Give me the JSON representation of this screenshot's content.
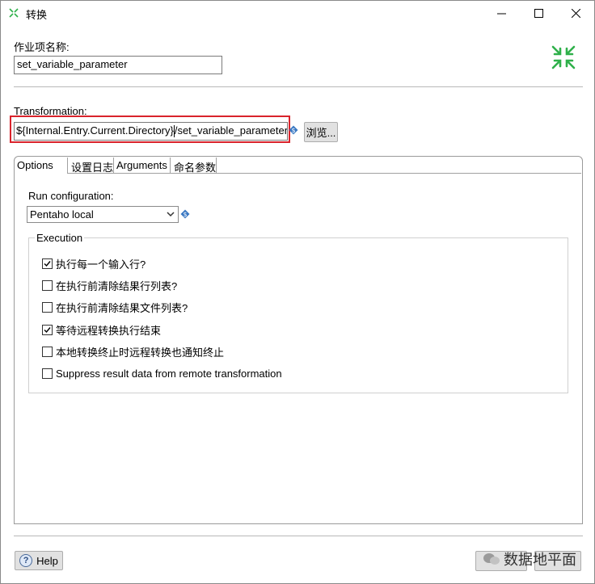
{
  "window": {
    "title": "转换",
    "app_icon": "spoon-transform-icon"
  },
  "form": {
    "job_entry_name_label": "作业项名称:",
    "job_entry_name_value": "set_variable_parameter",
    "transformation_label": "Transformation:",
    "transformation_path_prefix": "${Internal.Entry.Current.Directory}",
    "transformation_path_suffix": "/set_variable_parameter",
    "browse_label": "浏览...",
    "minimize_icon": "collapse-arrows-icon"
  },
  "tabs": [
    {
      "label": "Options",
      "active": true
    },
    {
      "label": "设置日志",
      "active": false
    },
    {
      "label": "Arguments",
      "active": false
    },
    {
      "label": "命名参数",
      "active": false
    }
  ],
  "options": {
    "run_config_label": "Run configuration:",
    "run_config_value": "Pentaho local",
    "execution_group": "Execution",
    "checks": [
      {
        "label": "执行每一个输入行?",
        "checked": true
      },
      {
        "label": "在执行前清除结果行列表?",
        "checked": false
      },
      {
        "label": "在执行前清除结果文件列表?",
        "checked": false
      },
      {
        "label": "等待远程转换执行结束",
        "checked": true
      },
      {
        "label": "本地转换终止时远程转换也通知终止",
        "checked": false
      },
      {
        "label": "Suppress result data from remote transformation",
        "checked": false
      }
    ]
  },
  "footer": {
    "help_label": "Help",
    "watermark": "数据地平面"
  },
  "colors": {
    "highlight": "#d9232b",
    "accent_green": "#2fb04a"
  }
}
